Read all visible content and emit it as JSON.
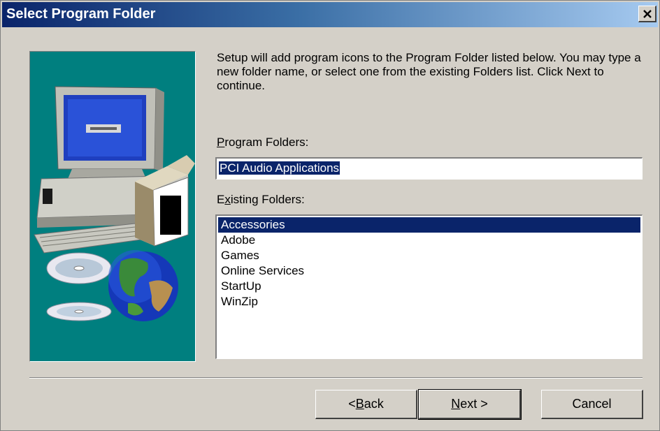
{
  "window": {
    "title": "Select Program Folder",
    "close_glyph": "✕"
  },
  "intro": {
    "text": "Setup will add program icons to the Program Folder listed below. You may type a new folder name, or select one from the existing Folders list.  Click Next to continue."
  },
  "program_folders": {
    "label_mnemonic": "P",
    "label_rest": "rogram Folders:",
    "value": "PCI Audio Applications"
  },
  "existing_folders": {
    "label_pre": "E",
    "label_mnemonic": "x",
    "label_rest": "isting Folders:",
    "items": [
      "Accessories",
      "Adobe",
      "Games",
      "Online Services",
      "StartUp",
      "WinZip"
    ],
    "selected": "Accessories"
  },
  "buttons": {
    "back_pre": "< ",
    "back_mnemonic": "B",
    "back_rest": "ack",
    "next_mnemonic": "N",
    "next_rest": "ext >",
    "cancel": "Cancel"
  },
  "colors": {
    "titlebar_start": "#0a246a",
    "titlebar_end": "#a6caf0",
    "panel_bg": "#007f7f",
    "selection": "#0a246a",
    "face": "#d4d0c8"
  },
  "icons": {
    "close": "close-icon",
    "illustration": [
      "computer-icon",
      "software-box-icon",
      "cd-disc-icon",
      "globe-icon"
    ]
  }
}
